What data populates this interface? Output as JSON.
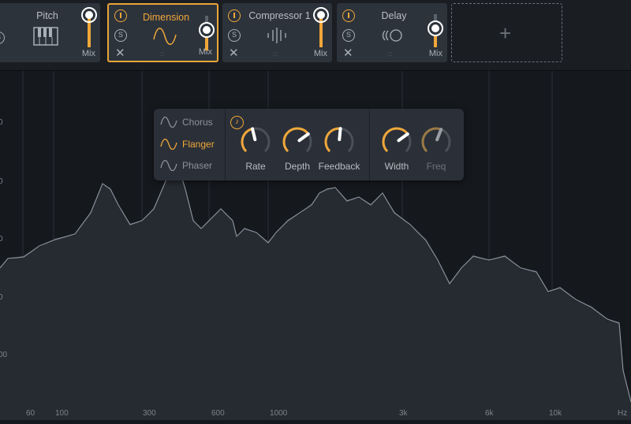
{
  "modules": [
    {
      "name": "Pitch",
      "mix_label": "Mix",
      "icon": "piano-icon",
      "mix": 0.95
    },
    {
      "name": "Dimension",
      "mix_label": "Mix",
      "icon": "sine-wave-icon",
      "mix": 0.55,
      "selected": true
    },
    {
      "name": "Compressor 1",
      "mix_label": "Mix",
      "icon": "compressor-bars-icon",
      "mix": 0.95
    },
    {
      "name": "Delay",
      "mix_label": "Mix",
      "icon": "delay-icon",
      "mix": 0.6
    }
  ],
  "add_slot": {
    "label": "+"
  },
  "effect_panel": {
    "modes": [
      {
        "label": "Chorus"
      },
      {
        "label": "Flanger",
        "active": true
      },
      {
        "label": "Phaser"
      }
    ],
    "knobs": [
      {
        "label": "Rate",
        "value": 0.45
      },
      {
        "label": "Depth",
        "value": 0.7
      },
      {
        "label": "Feedback",
        "value": 0.52
      },
      {
        "label": "Width",
        "value": 0.7
      },
      {
        "label": "Freq",
        "value": 0.58,
        "dim": true
      }
    ]
  },
  "freq_axis": [
    "60",
    "100",
    "300",
    "600",
    "1000",
    "3k",
    "6k",
    "10k",
    "Hz"
  ],
  "db_axis": [
    "0",
    "0",
    "0",
    "0",
    "00"
  ],
  "colors": {
    "accent": "#f0a73a",
    "panel": "#2d333b",
    "bg": "#15181d"
  }
}
